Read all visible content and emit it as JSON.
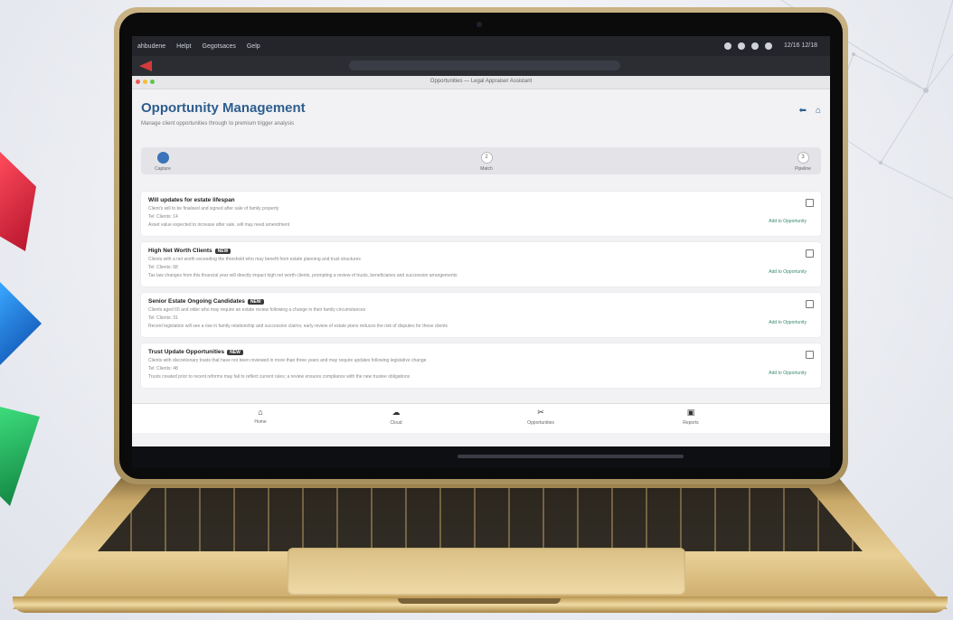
{
  "menubar": {
    "items": [
      "ahbudene",
      "Helpt",
      "Gegotsaces",
      "Gelp"
    ],
    "clock": "12/16 12/18"
  },
  "window": {
    "title": "Opportunities — Legal Appraiser Assistant"
  },
  "page": {
    "title": "Opportunity Management",
    "subtitle": "Manage client opportunities through to premium trigger analysis"
  },
  "stepper": {
    "steps": [
      {
        "num": "1",
        "label": "Capture"
      },
      {
        "num": "2",
        "label": "Match"
      },
      {
        "num": "3",
        "label": "Pipeline"
      }
    ]
  },
  "cards": [
    {
      "title": "Will updates for estate lifespan",
      "badge": "",
      "line1": "Client's will to be finalised and signed after sale of family property",
      "line2": "Tel: Clients: 14",
      "line3": "Asset value expected to increase after sale, will may need amendment",
      "link": "Add to Opportunity"
    },
    {
      "title": "High Net Worth Clients",
      "badge": "NEW",
      "line1": "Clients with a net worth exceeding the threshold who may benefit from estate planning and trust structures",
      "line2": "Tel: Clients: 68",
      "line3": "Tax law changes from this financial year will directly impact high net worth clients, prompting a review of trusts, beneficiaries and succession arrangements",
      "link": "Add to Opportunity"
    },
    {
      "title": "Senior Estate Ongoing Candidates",
      "badge": "NEW",
      "line1": "Clients aged 65 and older who may require an estate review following a change in their family circumstances",
      "line2": "Tel: Clients: 31",
      "line3": "Recent legislation will see a rise in family relationship and succession claims; early review of estate plans reduces the risk of disputes for these clients",
      "link": "Add to Opportunity"
    },
    {
      "title": "Trust Update Opportunities",
      "badge": "NEW",
      "line1": "Clients with discretionary trusts that have not been reviewed in more than three years and may require updates following legislative change",
      "line2": "Tel: Clients: 48",
      "line3": "Trusts created prior to recent reforms may fail to reflect current rules; a review ensures compliance with the new trustee obligations",
      "link": "Add to Opportunity"
    }
  ],
  "bottom_nav": [
    {
      "icon": "⌂",
      "label": "Home",
      "name": "home"
    },
    {
      "icon": "☁",
      "label": "Cloud",
      "name": "cloud"
    },
    {
      "icon": "✂",
      "label": "Opportunities",
      "name": "opportunities"
    },
    {
      "icon": "▣",
      "label": "Reports",
      "name": "reports"
    }
  ]
}
